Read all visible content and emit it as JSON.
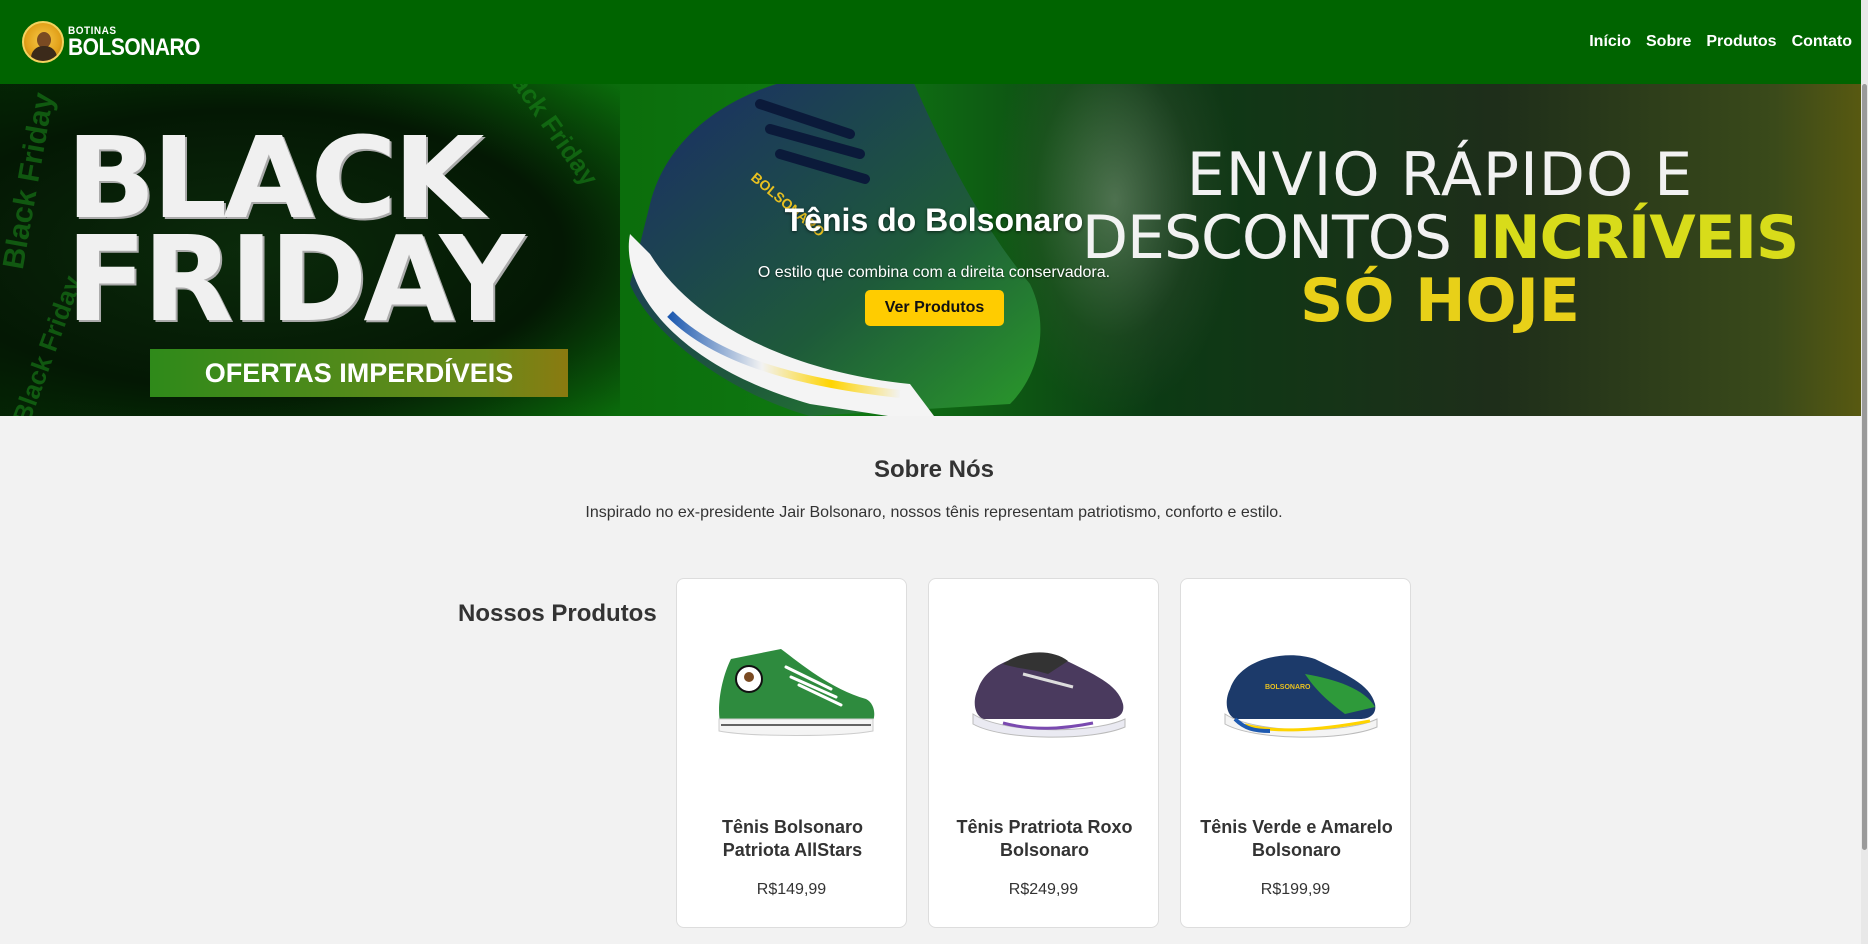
{
  "header": {
    "logo_small": "BOTINAS",
    "logo_big": "BOLSONARO",
    "nav": [
      "Início",
      "Sobre",
      "Produtos",
      "Contato"
    ]
  },
  "banner": {
    "bf_line1": "BLACK",
    "bf_line2": "FRIDAY",
    "offers": "OFERTAS IMPERDÍVEIS",
    "side_text": "Black Friday",
    "right_line1": "ENVIO RÁPIDO E",
    "right_line2a": "DESCONTOS ",
    "right_line2b": "INCRÍVEIS",
    "right_line3": "SÓ HOJE"
  },
  "hero": {
    "title": "Tênis do Bolsonaro",
    "subtitle": "O estilo que combina com a direita conservadora.",
    "button": "Ver Produtos"
  },
  "about": {
    "title": "Sobre Nós",
    "text": "Inspirado no ex-presidente Jair Bolsonaro, nossos tênis representam patriotismo, conforto e estilo."
  },
  "products": {
    "title": "Nossos Produtos",
    "items": [
      {
        "name": "Tênis Bolsonaro Patriota AllStars",
        "price": "R$149,99",
        "color": "#2e8b3e"
      },
      {
        "name": "Tênis Pratriota Roxo Bolsonaro",
        "price": "R$249,99",
        "color": "#4a3a5e"
      },
      {
        "name": "Tênis Verde e Amarelo Bolsonaro",
        "price": "R$199,99",
        "color": "#1c3a6a"
      }
    ]
  },
  "colors": {
    "header_bg": "#006400",
    "button_bg": "#ffcc00",
    "page_bg": "#f2f2f2"
  }
}
